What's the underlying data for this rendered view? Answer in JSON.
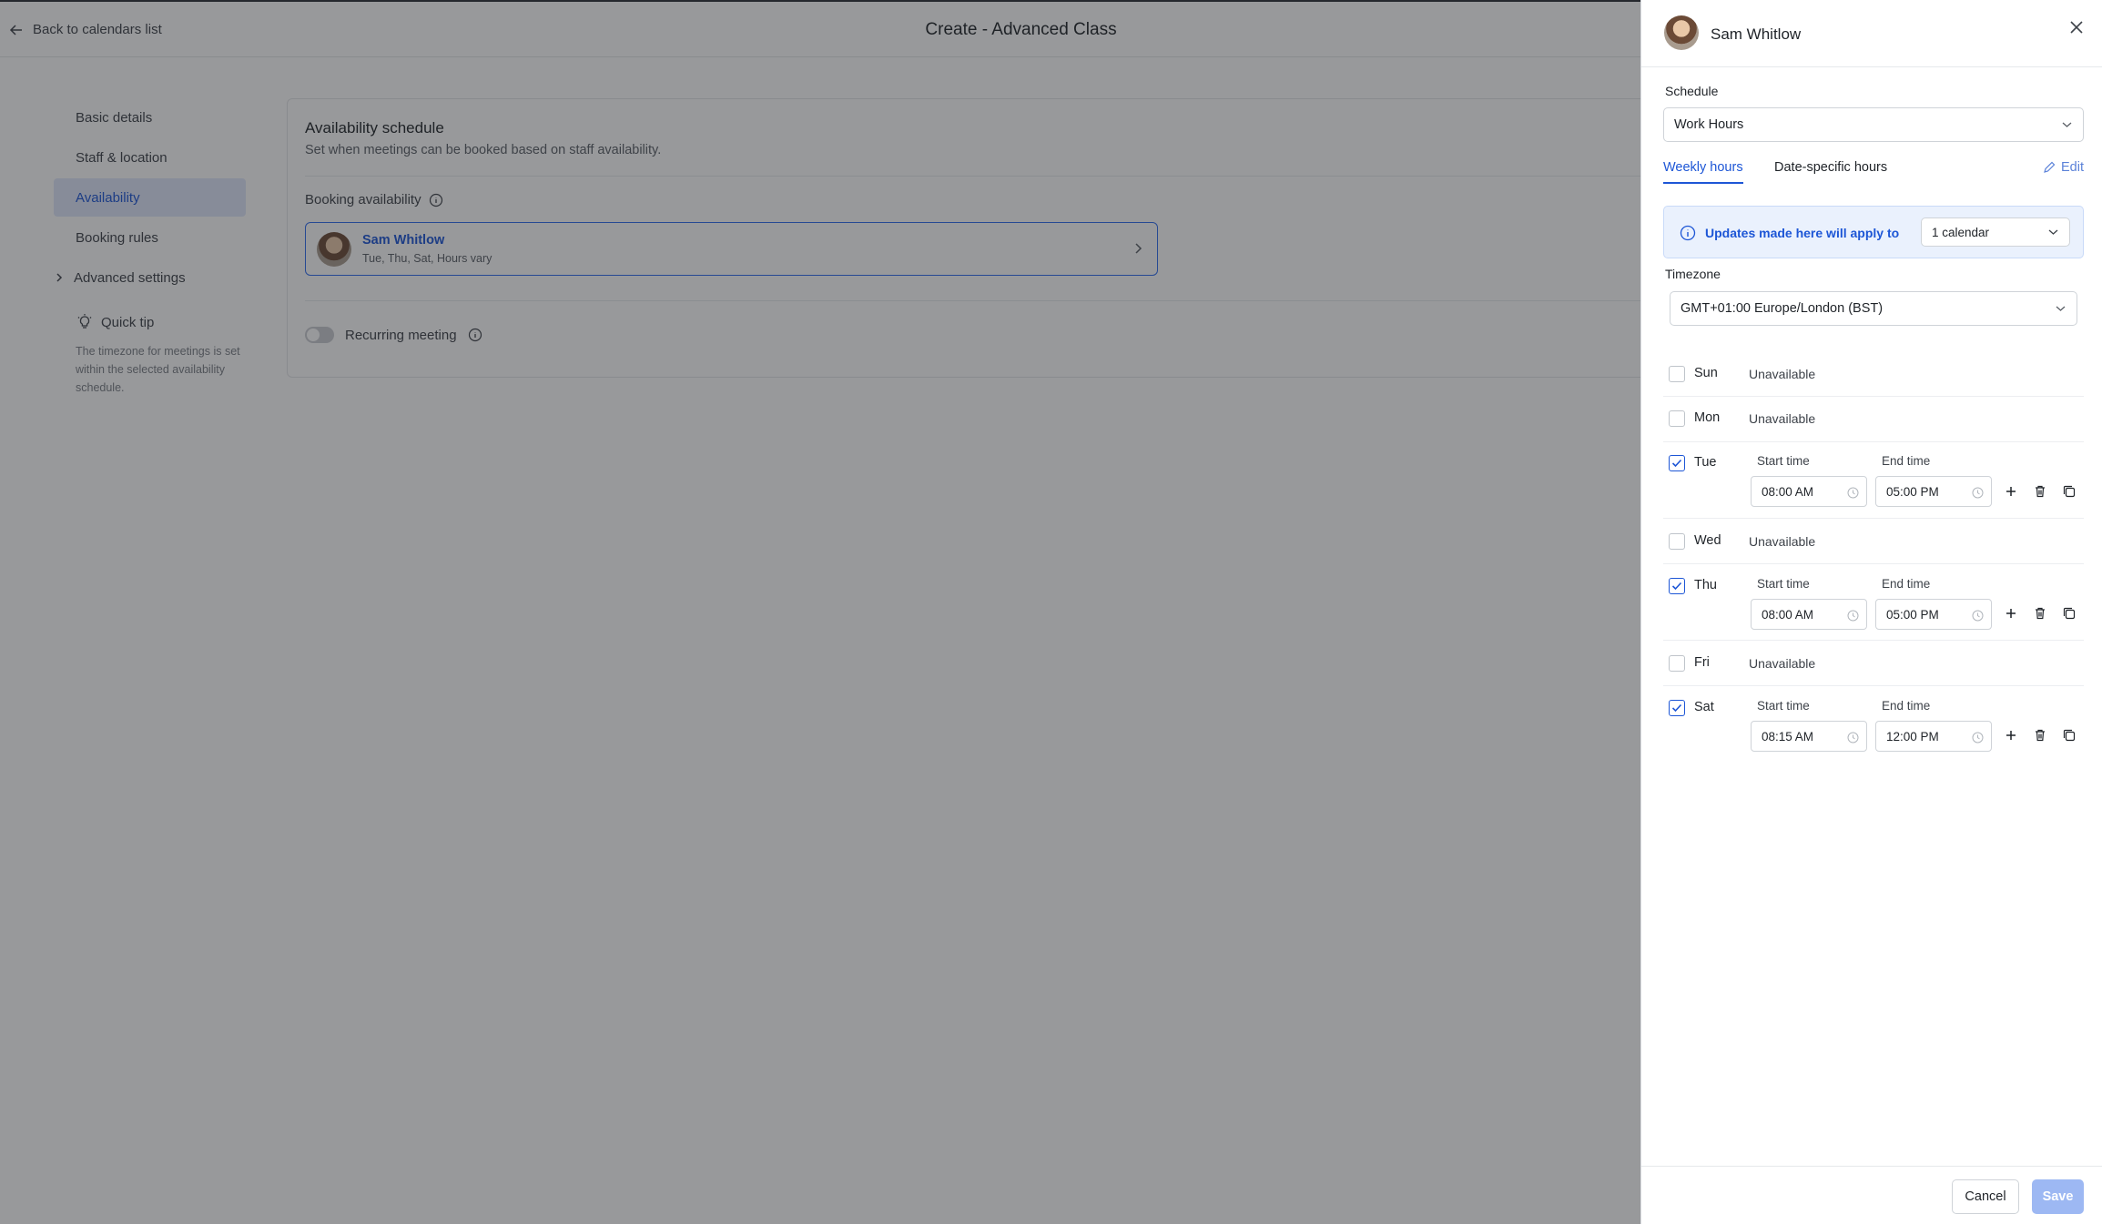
{
  "header": {
    "back_label": "Back to calendars list",
    "title": "Create - Advanced Class"
  },
  "nav": {
    "items": [
      {
        "label": "Basic details"
      },
      {
        "label": "Staff & location"
      },
      {
        "label": "Availability",
        "active": true
      },
      {
        "label": "Booking rules"
      }
    ],
    "advanced_label": "Advanced settings",
    "tip_title": "Quick tip",
    "tip_text": "The timezone for meetings is set within the selected availability schedule."
  },
  "availability": {
    "title": "Availability schedule",
    "subtitle": "Set when meetings can be booked based on staff availability.",
    "booking_label": "Booking availability",
    "staff_name": "Sam Whitlow",
    "staff_days": "Tue, Thu, Sat, Hours vary",
    "recurring_label": "Recurring meeting"
  },
  "drawer": {
    "name": "Sam Whitlow",
    "schedule_label": "Schedule",
    "schedule_value": "Work Hours",
    "tab_weekly": "Weekly hours",
    "tab_date": "Date-specific hours",
    "edit_label": "Edit",
    "notice_text": "Updates made here will apply to",
    "notice_select": "1 calendar",
    "timezone_label": "Timezone",
    "timezone_value": "GMT+01:00 Europe/London (BST)",
    "start_label": "Start time",
    "end_label": "End time",
    "unavailable_label": "Unavailable",
    "days": [
      {
        "day": "Sun",
        "checked": false
      },
      {
        "day": "Mon",
        "checked": false
      },
      {
        "day": "Tue",
        "checked": true,
        "start": "08:00 AM",
        "end": "05:00 PM"
      },
      {
        "day": "Wed",
        "checked": false
      },
      {
        "day": "Thu",
        "checked": true,
        "start": "08:00 AM",
        "end": "05:00 PM"
      },
      {
        "day": "Fri",
        "checked": false
      },
      {
        "day": "Sat",
        "checked": true,
        "start": "08:15 AM",
        "end": "12:00 PM"
      }
    ],
    "cancel_label": "Cancel",
    "save_label": "Save"
  },
  "colors": {
    "accent": "#1d56d6",
    "save_disabled": "#9db8f3",
    "notice_bg": "#eaf1fd"
  },
  "icons": [
    "arrow-left-icon",
    "chevron-right-icon",
    "lightbulb-icon",
    "info-icon",
    "close-icon",
    "chevron-down-icon",
    "pencil-icon",
    "check-icon",
    "clock-icon",
    "plus-icon",
    "trash-icon",
    "copy-icon"
  ]
}
